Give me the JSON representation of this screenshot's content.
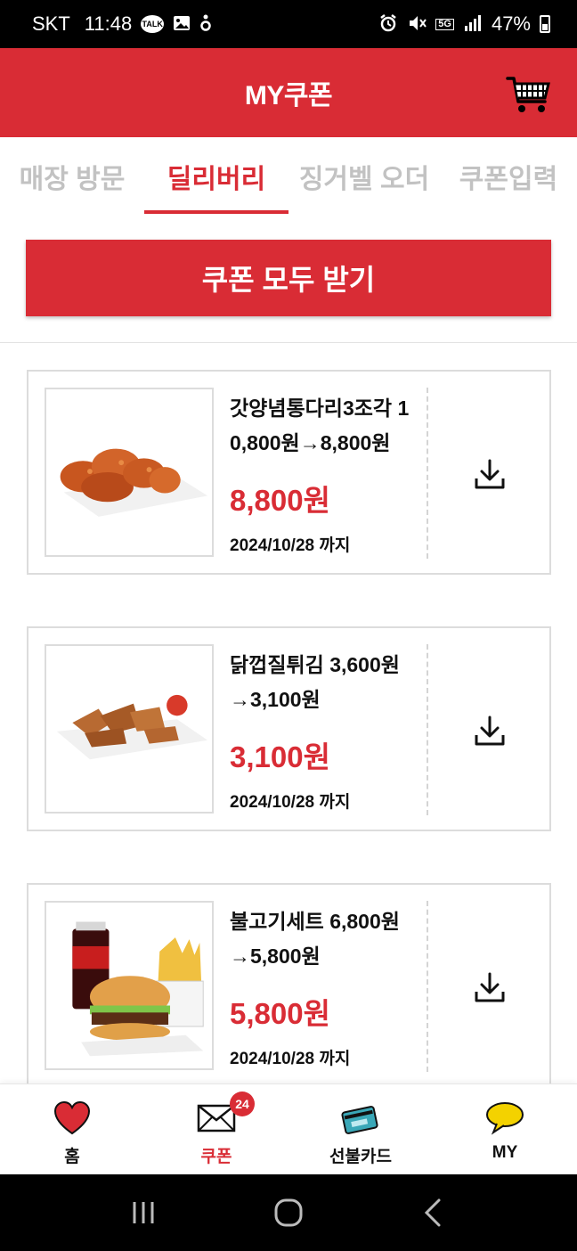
{
  "status_bar": {
    "carrier": "SKT",
    "time": "11:48",
    "talk_badge": "TALK",
    "network": "5G",
    "battery": "47%"
  },
  "header": {
    "title": "MY쿠폰"
  },
  "tabs": [
    {
      "label": "매장 방문",
      "active": false
    },
    {
      "label": "딜리버리",
      "active": true
    },
    {
      "label": "징거벨 오더",
      "active": false
    },
    {
      "label": "쿠폰입력",
      "active": false
    }
  ],
  "receive_all_label": "쿠폰 모두 받기",
  "coupons": [
    {
      "title": "갓양념통다리3조각 10,800원→8,800원",
      "price": "8,800원",
      "expiry": "2024/10/28 까지"
    },
    {
      "title": "닭껍질튀김 3,600원→3,100원",
      "price": "3,100원",
      "expiry": "2024/10/28 까지"
    },
    {
      "title": "불고기세트 6,800원→5,800원",
      "price": "5,800원",
      "expiry": "2024/10/28 까지"
    }
  ],
  "bottom_nav": {
    "items": [
      {
        "label": "홈",
        "icon": "heart-icon"
      },
      {
        "label": "쿠폰",
        "icon": "envelope-icon",
        "badge": "24",
        "active": true
      },
      {
        "label": "선불카드",
        "icon": "prepaid-card-icon"
      },
      {
        "label": "MY",
        "icon": "speech-bubble-icon"
      }
    ]
  },
  "colors": {
    "brand_red": "#d92c35",
    "inactive_tab": "#c2c2c2"
  }
}
